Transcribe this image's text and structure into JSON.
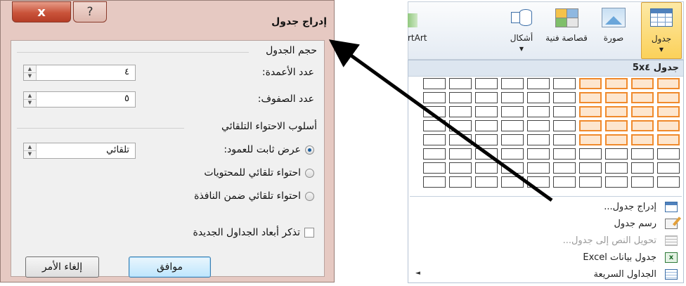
{
  "dialog": {
    "title": "إدراج جدول",
    "close_glyph": "x",
    "help_glyph": "?",
    "size_group": "حجم الجدول",
    "columns_label": "عدد الأعمدة:",
    "columns_value": "٤",
    "rows_label": "عدد الصفوف:",
    "rows_value": "٥",
    "autofit_group": "أسلوب الاحتواء التلقائي",
    "fixed_width_label": "عرض ثابت للعمود:",
    "fixed_width_value": "تلقائي",
    "autofit_contents_label": "احتواء تلقائي للمحتويات",
    "autofit_window_label": "احتواء تلقائي ضمن النافذة",
    "remember_label": "تذكر أبعاد الجداول الجديدة",
    "ok_label": "موافق",
    "cancel_label": "إلغاء الأمر",
    "selected_option": "fixed_width",
    "remember_checked": false
  },
  "ribbon": {
    "table": "جدول",
    "picture": "صورة",
    "clipart": "قصاصة فنية",
    "shapes": "أشكال",
    "smartart_partial": "rtArt"
  },
  "table_menu": {
    "header": "جدول 5x٤",
    "grid_columns": 10,
    "grid_rows": 8,
    "selected_columns": 4,
    "selected_rows": 5,
    "items": [
      {
        "label": "إدراج جدول...",
        "icon": "table-icon",
        "enabled": true
      },
      {
        "label": "رسم جدول",
        "icon": "draw-table-icon",
        "enabled": true
      },
      {
        "label": "تحويل النص إلى جدول...",
        "icon": "convert-text-icon",
        "enabled": false
      },
      {
        "label": "جدول بيانات Excel",
        "icon": "excel-icon",
        "enabled": true
      },
      {
        "label": "الجداول السريعة",
        "icon": "quick-tables-icon",
        "enabled": true,
        "submenu_glyph": "◄"
      }
    ]
  },
  "colors": {
    "dialog_frame": "#e6c9c2",
    "close_button": "#c9533a",
    "grid_highlight": "#f08a2c",
    "ribbon_active": "#fbd15a",
    "ok_button": "#bee6fd"
  }
}
